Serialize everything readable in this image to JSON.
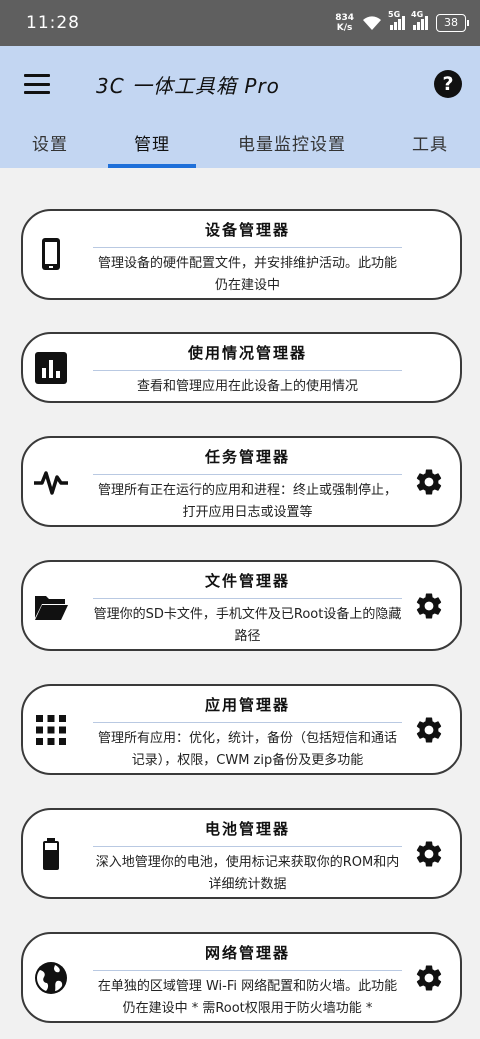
{
  "status_bar": {
    "time": "11:28",
    "net_speed_value": "834",
    "net_speed_unit": "K/s",
    "sim1": "5G",
    "sim2": "4G",
    "battery": "38"
  },
  "app_bar": {
    "title": "3C 一体工具箱 Pro",
    "help_label": "?"
  },
  "tabs": [
    {
      "label": "设置"
    },
    {
      "label": "管理"
    },
    {
      "label": "电量监控设置"
    },
    {
      "label": "工具"
    }
  ],
  "active_tab": "管理",
  "cards": [
    {
      "title": "设备管理器",
      "desc": "管理设备的硬件配置文件，并安排维护活动。此功能仍在建设中",
      "icon": "phone-icon",
      "has_settings": false
    },
    {
      "title": "使用情况管理器",
      "desc": "查看和管理应用在此设备上的使用情况",
      "icon": "bar-chart-icon",
      "has_settings": false
    },
    {
      "title": "任务管理器",
      "desc": "管理所有正在运行的应用和进程：终止或强制停止，打开应用日志或设置等",
      "icon": "activity-pulse-icon",
      "has_settings": true
    },
    {
      "title": "文件管理器",
      "desc": "管理你的SD卡文件，手机文件及已Root设备上的隐藏路径",
      "icon": "folder-open-icon",
      "has_settings": true
    },
    {
      "title": "应用管理器",
      "desc": "管理所有应用：优化，统计，备份（包括短信和通话记录），权限，CWM zip备份及更多功能",
      "icon": "apps-grid-icon",
      "has_settings": true
    },
    {
      "title": "电池管理器",
      "desc": "深入地管理你的电池，使用标记来获取你的ROM和内详细统计数据",
      "icon": "battery-icon",
      "has_settings": true
    },
    {
      "title": "网络管理器",
      "desc": "在单独的区域管理 Wi-Fi 网络配置和防火墙。此功能仍在建设中 * 需Root权限用于防火墙功能 *",
      "icon": "globe-icon",
      "has_settings": true
    }
  ],
  "colors": {
    "status_bar": "#5f5f5f",
    "app_bar": "#c3d6f2",
    "tab_indicator": "#1e6fd9",
    "background": "#f1f1f1",
    "card_border": "#3a3a3a"
  }
}
